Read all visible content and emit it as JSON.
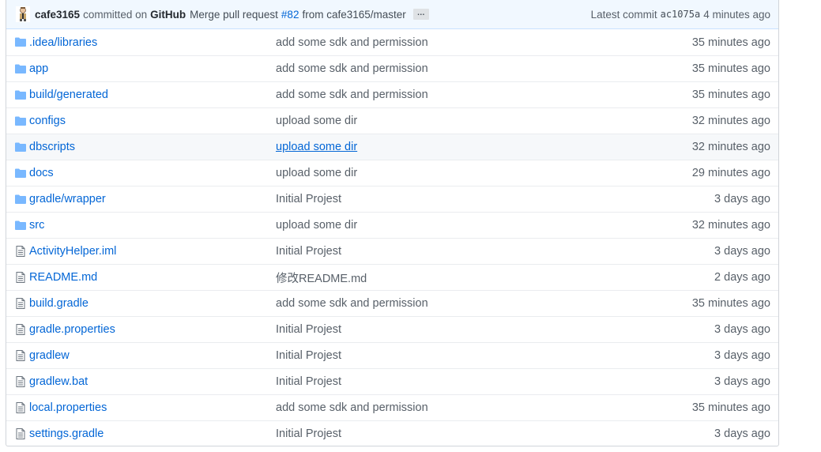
{
  "commit": {
    "author": "cafe3165",
    "committed_on_text": "committed on",
    "committer": "GitHub",
    "message_prefix": "Merge pull request",
    "pr_number": "#82",
    "message_suffix": "from cafe3165/master",
    "ellipsis": "…",
    "latest_label": "Latest commit",
    "sha": "ac1075a",
    "age": "4 minutes ago"
  },
  "files": [
    {
      "type": "dir",
      "name": ".idea/libraries",
      "message": "add some sdk and permission",
      "age": "35 minutes ago"
    },
    {
      "type": "dir",
      "name": "app",
      "message": "add some sdk and permission",
      "age": "35 minutes ago"
    },
    {
      "type": "dir",
      "name": "build/generated",
      "message": "add some sdk and permission",
      "age": "35 minutes ago"
    },
    {
      "type": "dir",
      "name": "configs",
      "message": "upload some dir",
      "age": "32 minutes ago"
    },
    {
      "type": "dir",
      "name": "dbscripts",
      "message": "upload some dir",
      "age": "32 minutes ago",
      "hover": true
    },
    {
      "type": "dir",
      "name": "docs",
      "message": "upload some dir",
      "age": "29 minutes ago"
    },
    {
      "type": "dir",
      "name": "gradle/wrapper",
      "message": "Initial Projest",
      "age": "3 days ago"
    },
    {
      "type": "dir",
      "name": "src",
      "message": "upload some dir",
      "age": "32 minutes ago"
    },
    {
      "type": "file",
      "name": "ActivityHelper.iml",
      "message": "Initial Projest",
      "age": "3 days ago"
    },
    {
      "type": "file",
      "name": "README.md",
      "message": "修改README.md",
      "age": "2 days ago"
    },
    {
      "type": "file",
      "name": "build.gradle",
      "message": "add some sdk and permission",
      "age": "35 minutes ago"
    },
    {
      "type": "file",
      "name": "gradle.properties",
      "message": "Initial Projest",
      "age": "3 days ago"
    },
    {
      "type": "file",
      "name": "gradlew",
      "message": "Initial Projest",
      "age": "3 days ago"
    },
    {
      "type": "file",
      "name": "gradlew.bat",
      "message": "Initial Projest",
      "age": "3 days ago"
    },
    {
      "type": "file",
      "name": "local.properties",
      "message": "add some sdk and permission",
      "age": "35 minutes ago"
    },
    {
      "type": "file",
      "name": "settings.gradle",
      "message": "Initial Projest",
      "age": "3 days ago"
    }
  ],
  "colors": {
    "link": "#0366d6",
    "folder_icon": "#79b8ff",
    "file_icon": "#6a737d",
    "commit_bar_bg": "#f1f8ff"
  },
  "icons": {
    "dir": "folder-icon",
    "file": "file-icon"
  }
}
